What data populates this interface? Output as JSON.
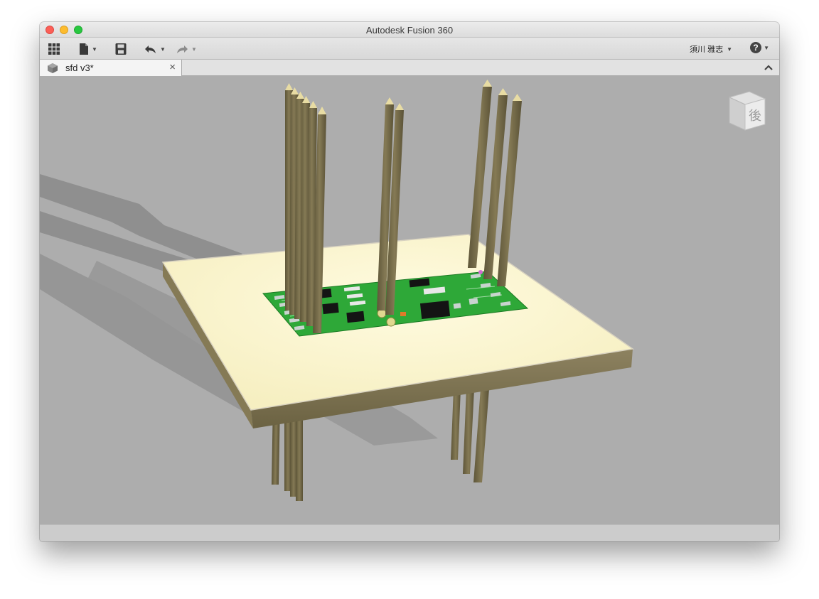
{
  "window": {
    "title": "Autodesk Fusion 360"
  },
  "toolbar": {
    "user_name": "須川 雅志"
  },
  "tabs": [
    {
      "label": "sfd v3*"
    }
  ],
  "viewcube": {
    "face_label": "後"
  },
  "colors": {
    "viewport_bg": "#adadad",
    "board_top": "#fbf6cc",
    "board_side": "#7b7150",
    "pcb_green": "#2ea838",
    "pin_color": "#6f6646"
  }
}
